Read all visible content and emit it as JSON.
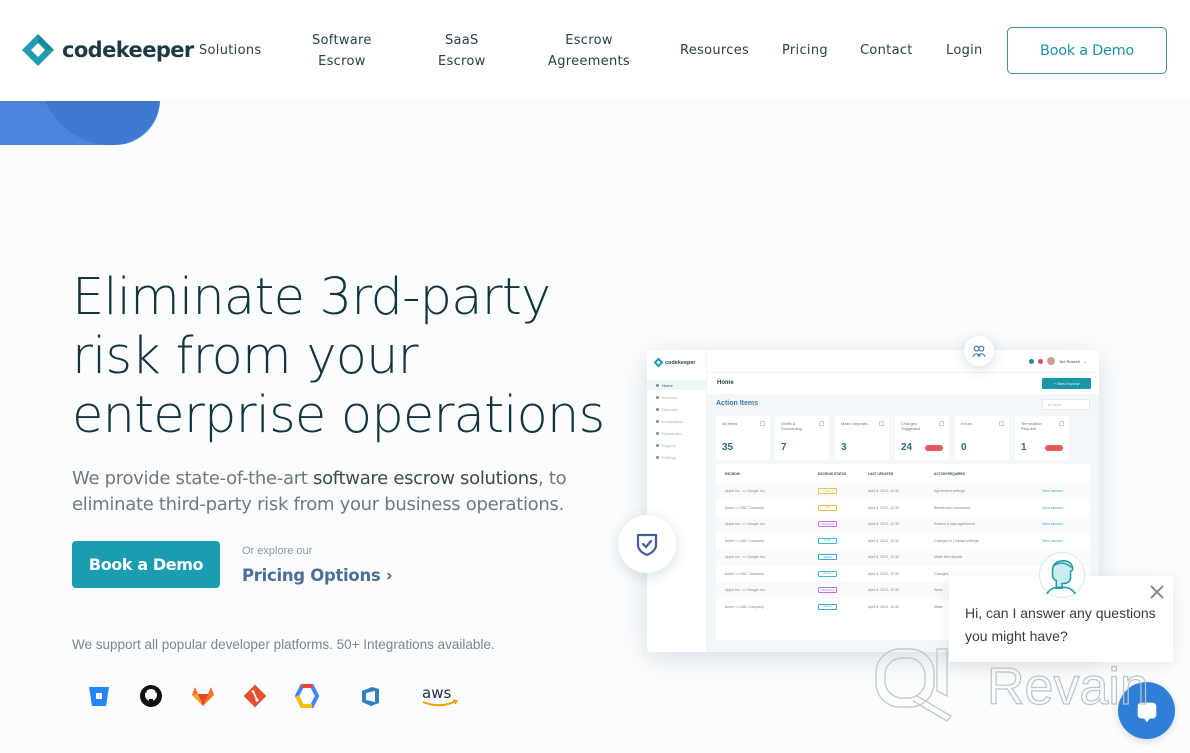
{
  "brand": {
    "name": "codekeeper",
    "accent": "#1a9db1",
    "logo_color": "#1f9cb0"
  },
  "nav": {
    "items": [
      {
        "label": "Solutions"
      },
      {
        "label": "Software\nEscrow"
      },
      {
        "label": "SaaS\nEscrow"
      },
      {
        "label": "Escrow\nAgreements"
      },
      {
        "label": "Resources"
      },
      {
        "label": "Pricing"
      },
      {
        "label": "Contact"
      },
      {
        "label": "Login"
      }
    ],
    "cta": "Book a Demo"
  },
  "hero": {
    "title_lines": [
      "Eliminate 3rd-party",
      "risk from your",
      "enterprise operations"
    ],
    "subtitle_pre": "We provide state-of-the-art ",
    "subtitle_bold": "software escrow solutions",
    "subtitle_post": ", to eliminate third-party risk from your business operations.",
    "cta": "Book a Demo",
    "explore_label": "Or explore our",
    "pricing_link": "Pricing Options",
    "pricing_chevron": "›",
    "support_text": "We support all popular developer platforms. 50+ Integrations available."
  },
  "integrations": [
    {
      "name": "bitbucket-icon",
      "color": "#2684ff"
    },
    {
      "name": "github-icon",
      "color": "#111111"
    },
    {
      "name": "gitlab-icon",
      "color": "#fc6d26"
    },
    {
      "name": "git-icon",
      "color": "#e84e31"
    },
    {
      "name": "google-cloud-icon",
      "color": "#4285f4"
    },
    {
      "name": "azure-devops-icon",
      "color": "#2f7fc1"
    },
    {
      "name": "aws-icon",
      "label": "aws",
      "color": "#232f3e",
      "smile": "#f90"
    }
  ],
  "dashboard": {
    "logo": "codekeeper",
    "sidebar": [
      "Home",
      "Escrows",
      "Deposits",
      "Integrations",
      "Signatures",
      "Support",
      "Settings"
    ],
    "user": "Ted Russell",
    "page_title": "Home",
    "new_button": "+ New Escrow",
    "section_title": "Action Items",
    "filter": "All items",
    "stats": [
      {
        "label": "All Items",
        "value": "35"
      },
      {
        "label": "Drafts & Onboarding",
        "value": "7"
      },
      {
        "label": "Make Deposits",
        "value": "3"
      },
      {
        "label": "Changes Suggested",
        "value": "24",
        "badge": true
      },
      {
        "label": "Errors",
        "value": "0"
      },
      {
        "label": "Termination Request",
        "value": "1",
        "badge": true
      }
    ],
    "table": {
      "headers": [
        "ESCROW",
        "ESCROW STATUS",
        "LAST UPDATED",
        "ACTION REQUIRED"
      ],
      "rows": [
        {
          "escrow": "Apple Inc. <> Google Inc.",
          "status": "Draft",
          "status_color": "#e8c04a",
          "updated": "April 6, 2021, 12:32",
          "action": "Agreement settings",
          "link": "View escrow ›"
        },
        {
          "escrow": "Acme <> ABC Company",
          "status": "Draft",
          "status_color": "#e8c04a",
          "updated": "April 6, 2021, 12:32",
          "action": "Beneficiary information",
          "link": "View escrow ›"
        },
        {
          "escrow": "Apple Inc. <> Google Inc.",
          "status": "Onboarding",
          "status_color": "#c377e0",
          "updated": "April 6, 2021, 12:32",
          "action": "Review & sign agreement",
          "link": "View escrow ›"
        },
        {
          "escrow": "Acme <> ABC Company",
          "status": "Active",
          "status_color": "#3dbfd1",
          "updated": "April 6, 2021, 12:32",
          "action": "Changes in Deposit settings",
          "link": "View escrow ›"
        },
        {
          "escrow": "Apple Inc. <> Google Inc.",
          "status": "Signed",
          "status_color": "#3da8d8",
          "updated": "April 6, 2021, 12:32",
          "action": "Make first deposit",
          "link": ""
        },
        {
          "escrow": "Acme <> ABC Company",
          "status": "Active",
          "status_color": "#3dbfd1",
          "updated": "April 6, 2021, 12:32",
          "action": "Changes",
          "link": ""
        },
        {
          "escrow": "Apple Inc. <> Google Inc.",
          "status": "Onboarding",
          "status_color": "#c377e0",
          "updated": "April 6, 2021, 12:32",
          "action": "Send",
          "link": ""
        },
        {
          "escrow": "Acme <> ABC Company",
          "status": "Signed",
          "status_color": "#3da8d8",
          "updated": "April 6, 2021, 12:32",
          "action": "Make",
          "link": ""
        }
      ]
    }
  },
  "chat": {
    "message": "Hi, can I answer any questions you might have?",
    "close_icon": "close-icon",
    "launcher_color": "#2f7fd9"
  },
  "watermark": {
    "text": "Revain"
  }
}
